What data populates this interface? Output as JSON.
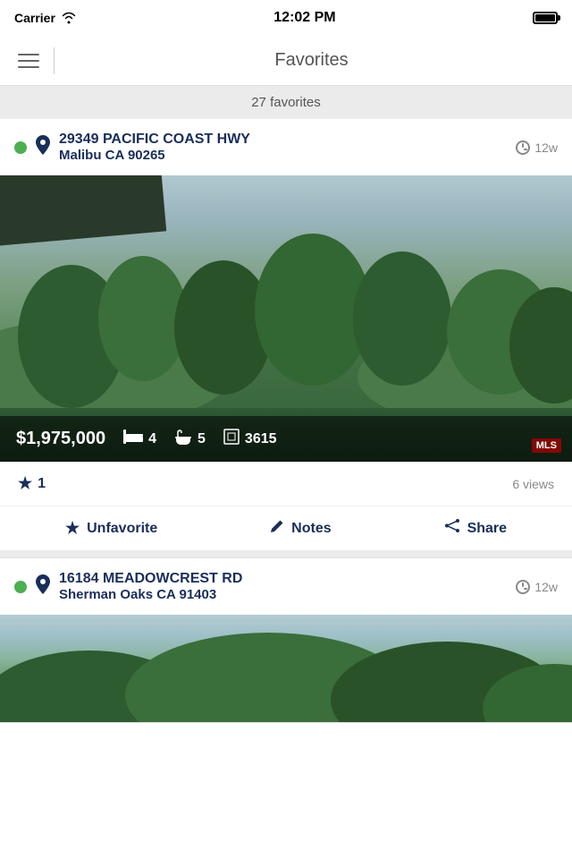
{
  "statusBar": {
    "carrier": "Carrier",
    "time": "12:02 PM",
    "wifi": true,
    "battery": "full"
  },
  "header": {
    "title": "Favorites",
    "menuLabel": "menu"
  },
  "favoritesBar": {
    "label": "27 favorites"
  },
  "listings": [
    {
      "id": "listing-1",
      "statusDot": "active",
      "street": "29349 PACIFIC COAST HWY",
      "city": "Malibu CA 90265",
      "timeAgo": "12w",
      "price": "$1,975,000",
      "beds": "4",
      "baths": "5",
      "sqft": "3615",
      "starCount": "1",
      "views": "6 views",
      "actions": {
        "unfavorite": "Unfavorite",
        "notes": "Notes",
        "share": "Share"
      }
    },
    {
      "id": "listing-2",
      "statusDot": "active",
      "street": "16184 MEADOWCREST RD",
      "city": "Sherman Oaks CA 91403",
      "timeAgo": "12w"
    }
  ],
  "icons": {
    "star": "★",
    "pin": "📍",
    "bed": "🛏",
    "bath": "🛁",
    "sqft": "⊡",
    "pencil": "✏",
    "share": "⋘",
    "clock": "🕐"
  }
}
